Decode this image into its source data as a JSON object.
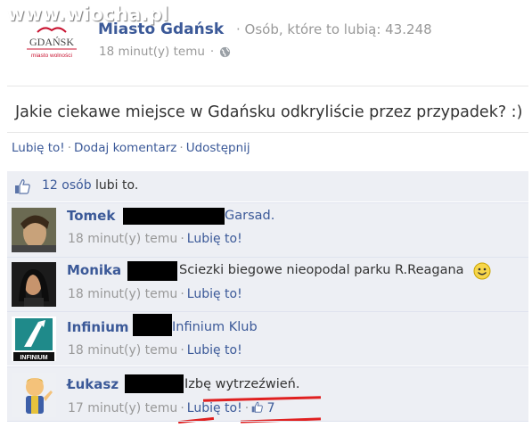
{
  "watermark": "www.wiocha.pl",
  "page": {
    "logo_text": "GDAŃSK",
    "logo_subtext": "miasto wolności",
    "title": "Miasto Gdańsk",
    "likes_info": "· Osób, które to lubią: 43.248",
    "time": "18 minut(y) temu",
    "separator": "·"
  },
  "post": {
    "text": "Jakie ciekawe miejsce w Gdańsku odkryliście przez przypadek? :)"
  },
  "actions": {
    "like": "Lubię to!",
    "comment": "Dodaj komentarz",
    "share": "Udostępnij",
    "sep": "·"
  },
  "likes": {
    "count_link": "12 osób",
    "suffix": " lubi to."
  },
  "comments": [
    {
      "name": "Tomek",
      "text": "Garsad.",
      "time": "18 minut(y) temu",
      "like": "Lubię to!"
    },
    {
      "name": "Monika",
      "text": "Sciezki biegowe nieopodal parku R.Reagana",
      "time": "18 minut(y) temu",
      "like": "Lubię to!"
    },
    {
      "name": "Infinium",
      "text": "Infinium Klub",
      "avatar_text": "INFINIUM",
      "time": "18 minut(y) temu",
      "like": "Lubię to!"
    },
    {
      "name": "Łukasz",
      "text": "Izbę wytrzeźwień.",
      "time": "17 minut(y) temu",
      "like": "Lubię to!",
      "like_count": "7"
    }
  ],
  "colors": {
    "link_blue": "#3b5998",
    "muted_gray": "#999999",
    "comment_bg": "#edeff4",
    "highlight_red": "#e02020"
  }
}
